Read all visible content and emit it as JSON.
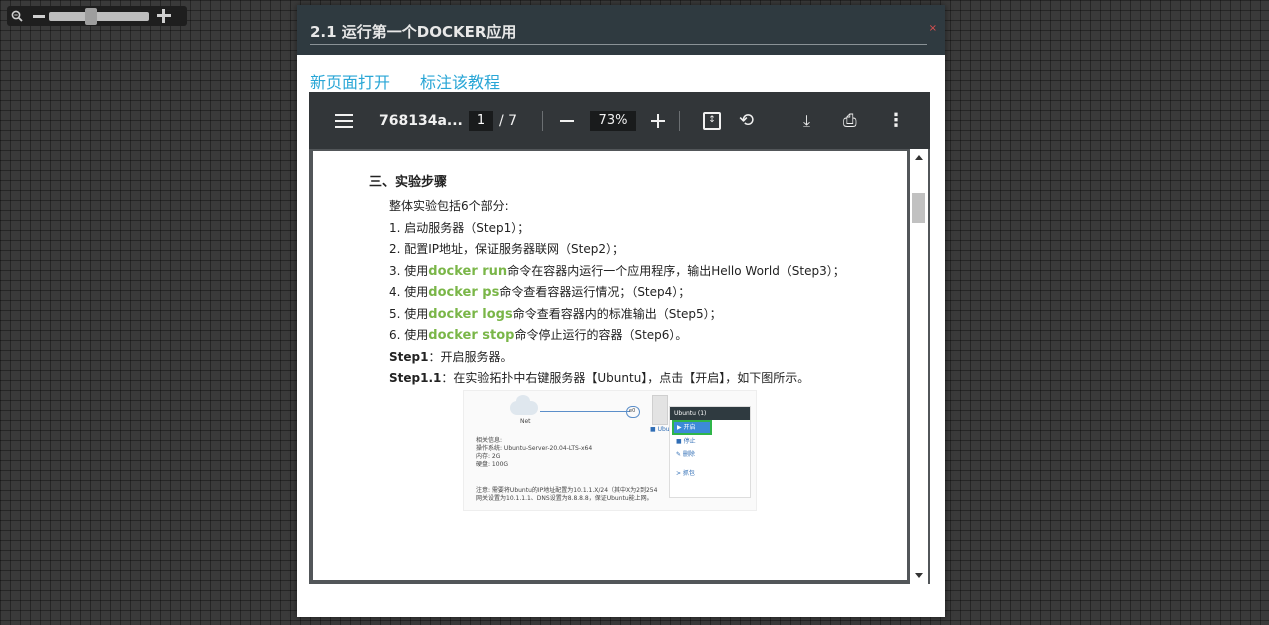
{
  "dialog": {
    "title": "2.1 运行第一个DOCKER应用",
    "close": "×",
    "links": [
      "新页面打开",
      "标注该教程"
    ]
  },
  "viewer": {
    "file_name": "768134a...",
    "page_current": "1",
    "page_total": "/ 7",
    "zoom": "73%"
  },
  "document": {
    "heading": "三、实验步骤",
    "intro": "整体实验包括6个部分:",
    "steps": [
      {
        "pre": "1. 启动服务器（Step1）；",
        "cmd": "",
        "post": ""
      },
      {
        "pre": "2. 配置IP地址，保证服务器联网（Step2）；",
        "cmd": "",
        "post": ""
      },
      {
        "pre": "3. 使用",
        "cmd": "docker run",
        "post": "命令在容器内运行一个应用程序，输出Hello World（Step3）；"
      },
      {
        "pre": "4. 使用",
        "cmd": "docker ps",
        "post": "命令查看容器运行情况；（Step4）；"
      },
      {
        "pre": "5. 使用",
        "cmd": "docker logs",
        "post": "命令查看容器内的标准输出（Step5）；"
      },
      {
        "pre": "6. 使用",
        "cmd": "docker stop",
        "post": "命令停止运行的容器（Step6）。"
      }
    ],
    "step1_label": "Step1",
    "step1_text": "：开启服务器。",
    "step11_label": "Step1.1",
    "step11_text": "：在实验拓扑中右键服务器【Ubuntu】，点击【开启】，如下图所示。"
  },
  "figure": {
    "net_label": "Net",
    "node_label": "e0",
    "server_label": "■ Ubu",
    "menu_title": "Ubuntu (1)",
    "menu_items": [
      "▶ 开启",
      "■ 停止",
      "✎ 删除",
      "> 抓包"
    ],
    "info_lines": [
      "相关信息:",
      "操作系统: Ubuntu-Server-20.04-LTS-x64",
      "内存: 2G",
      "硬盘: 100G"
    ],
    "note_lines": [
      "注意: 需要将Ubuntu的IP地址配置为10.1.1.X/24（其中X为2到254",
      "网关设置为10.1.1.1、DNS设置为8.8.8.8，保证Ubuntu能上网。"
    ]
  }
}
